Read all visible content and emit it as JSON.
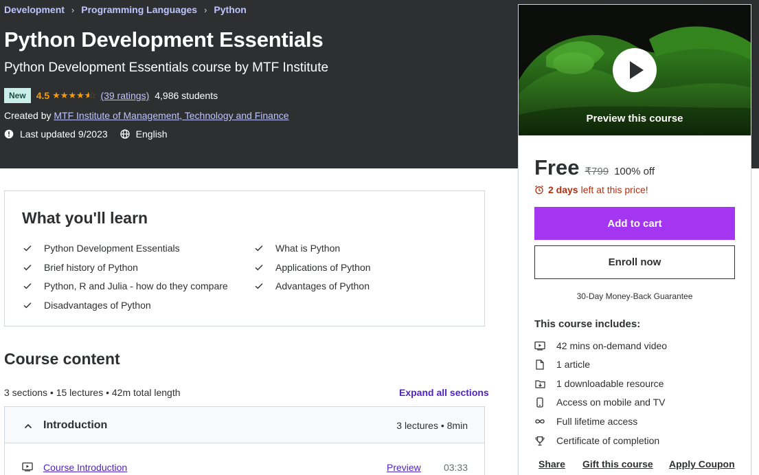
{
  "breadcrumb": [
    "Development",
    "Programming Languages",
    "Python"
  ],
  "course": {
    "title": "Python Development Essentials",
    "subtitle": "Python Development Essentials course by MTF Institute",
    "badge": "New",
    "rating": "4.5",
    "ratings_count": "(39 ratings)",
    "students": "4,986 students",
    "created_by_label": "Created by",
    "instructor": "MTF Institute of Management, Technology and Finance",
    "last_updated": "Last updated 9/2023",
    "language": "English"
  },
  "learn": {
    "title": "What you'll learn",
    "items": [
      "Python Development Essentials",
      "What is Python",
      "Brief history of Python",
      "Applications of Python",
      "Python, R and Julia - how do they compare",
      "Advantages of Python",
      "Disadvantages of Python"
    ]
  },
  "content": {
    "title": "Course content",
    "stats": "3 sections • 15 lectures • 42m total length",
    "expand_label": "Expand all sections",
    "section": {
      "name": "Introduction",
      "stats": "3 lectures • 8min"
    },
    "lecture": {
      "name": "Course Introduction",
      "preview": "Preview",
      "duration": "03:33"
    }
  },
  "sidebar": {
    "preview_label": "Preview this course",
    "price": "Free",
    "original_price": "₹799",
    "discount": "100% off",
    "timer_bold": "2 days",
    "timer_rest": "left at this price!",
    "cart_label": "Add to cart",
    "enroll_label": "Enroll now",
    "guarantee": "30-Day Money-Back Guarantee",
    "includes_title": "This course includes:",
    "includes": [
      {
        "icon": "video-icon",
        "text": "42 mins on-demand video"
      },
      {
        "icon": "file-icon",
        "text": "1 article"
      },
      {
        "icon": "download-icon",
        "text": "1 downloadable resource"
      },
      {
        "icon": "mobile-icon",
        "text": "Access on mobile and TV"
      },
      {
        "icon": "infinity-icon",
        "text": "Full lifetime access"
      },
      {
        "icon": "trophy-icon",
        "text": "Certificate of completion"
      }
    ],
    "share_label": "Share",
    "gift_label": "Gift this course",
    "coupon_label": "Apply Coupon"
  },
  "colors": {
    "hero_bg": "#2d2f31",
    "accent_purple": "#a435f0",
    "link_purple": "#5022c3",
    "star_orange": "#f69c08",
    "timer_red": "#b32d0f"
  }
}
